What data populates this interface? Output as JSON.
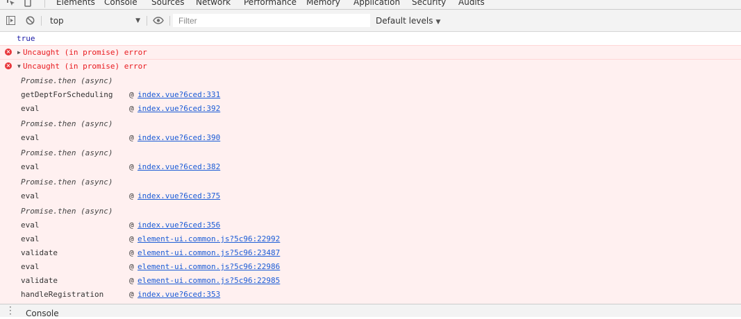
{
  "tabs": [
    "Elements",
    "Console",
    "Sources",
    "Network",
    "Performance",
    "Memory",
    "Application",
    "Security",
    "Audits"
  ],
  "active_tab": "Console",
  "toolbar": {
    "context": "top",
    "filter_placeholder": "Filter",
    "levels": "Default levels"
  },
  "messages": {
    "result": "true",
    "error_collapsed": "Uncaught (in promise) error",
    "error_expanded": "Uncaught (in promise) error"
  },
  "stack": [
    {
      "label": "Promise.then (async)",
      "async": true
    },
    {
      "label": "getDeptForScheduling",
      "link": "index.vue?6ced:331"
    },
    {
      "label": "eval",
      "link": "index.vue?6ced:392"
    },
    {
      "label": "Promise.then (async)",
      "async": true
    },
    {
      "label": "eval",
      "link": "index.vue?6ced:390"
    },
    {
      "label": "Promise.then (async)",
      "async": true
    },
    {
      "label": "eval",
      "link": "index.vue?6ced:382"
    },
    {
      "label": "Promise.then (async)",
      "async": true
    },
    {
      "label": "eval",
      "link": "index.vue?6ced:375"
    },
    {
      "label": "Promise.then (async)",
      "async": true
    },
    {
      "label": "eval",
      "link": "index.vue?6ced:356"
    },
    {
      "label": "eval",
      "link": "element-ui.common.js?5c96:22992"
    },
    {
      "label": "validate",
      "link": "element-ui.common.js?5c96:23487"
    },
    {
      "label": "eval",
      "link": "element-ui.common.js?5c96:22986"
    },
    {
      "label": "validate",
      "link": "element-ui.common.js?5c96:22985"
    },
    {
      "label": "handleRegistration",
      "link": "index.vue?6ced:353"
    }
  ],
  "stack_at": "@",
  "drawer": {
    "label": "Console"
  },
  "colors": {
    "error_text": "#e8191e",
    "error_bg": "#fff0f0",
    "link": "#1a5bd6",
    "accent": "#1a73e8"
  }
}
